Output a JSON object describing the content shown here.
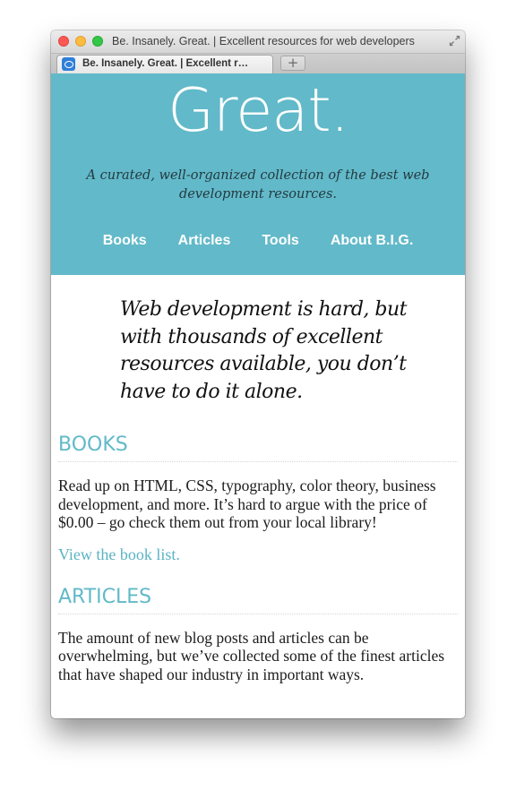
{
  "window": {
    "title": "Be. Insanely. Great. | Excellent resources for web developers"
  },
  "tabs": [
    {
      "label": "Be. Insanely. Great. | Excellent r…"
    }
  ],
  "new_tab_label": "+",
  "site": {
    "logo": "Great.",
    "tagline": "A curated, well-organized collection of the best web development resources.",
    "nav": [
      "Books",
      "Articles",
      "Tools",
      "About B.I.G."
    ],
    "intro": "Web development is hard, but with thousands of excellent resources available, you don’t have to do it alone."
  },
  "sections": {
    "books": {
      "heading": "BOOKS",
      "body": "Read up on HTML, CSS, typography, color theory, business development, and more. It’s hard to argue with the price of $0.00 – go check them out from your local library!",
      "link": "View the book list."
    },
    "articles": {
      "heading": "ARTICLES",
      "body": "The amount of new blog posts and articles can be overwhelming, but we’ve collected some of the finest articles that have shaped our industry in important ways."
    }
  },
  "icons": {
    "window_close": "close-button-icon",
    "window_minimize": "minimize-button-icon",
    "window_zoom": "zoom-button-icon",
    "fullscreen": "expand-arrows-icon",
    "tab_favicon": "site-favicon-icon"
  },
  "colors": {
    "masthead": "#62b9c9",
    "heading": "#62b9c9",
    "link": "#5ab3c4",
    "nav_text": "#ffffff",
    "traffic_close": "#fc5753",
    "traffic_minimize": "#fdbc40",
    "traffic_zoom": "#33c748"
  }
}
